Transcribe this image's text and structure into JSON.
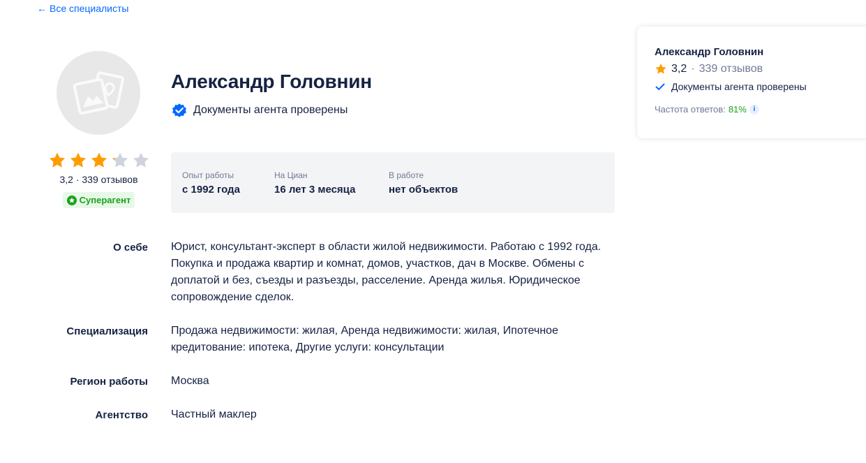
{
  "nav": {
    "back_arrow": "←",
    "back_label": "Все специалисты"
  },
  "profile": {
    "name": "Александр Головнин",
    "verified_text": "Документы агента проверены",
    "rating_text": "3,2 · 339 отзывов",
    "rating_value": 3.2,
    "rating_max": 5,
    "badge": "Суперагент"
  },
  "stats": [
    {
      "label": "Опыт работы",
      "value": "с 1992 года"
    },
    {
      "label": "На Циан",
      "value": "16 лет 3 месяца"
    },
    {
      "label": "В работе",
      "value": "нет объектов"
    }
  ],
  "info": [
    {
      "label": "О себе",
      "value": "Юрист, консультант-эксперт в области жилой недвижимости. Работаю с 1992 года. Покупка и продажа квартир и комнат, домов, участков, дач в Москве. Обмены с доплатой и без, съезды и разъезды, расселение. Аренда жилья. Юридическое сопровождение сделок."
    },
    {
      "label": "Специализация",
      "value": "Продажа недвижимости: жилая, Аренда недвижимости: жилая, Ипотечное кредитование: ипотека, Другие услуги: консультации"
    },
    {
      "label": "Регион работы",
      "value": "Москва"
    },
    {
      "label": "Агентство",
      "value": "Частный маклер"
    }
  ],
  "side_card": {
    "name": "Александр Головнин",
    "rating": "3,2",
    "separator": "·",
    "reviews": "339 отзывов",
    "verified_text": "Документы агента проверены",
    "freq_label": "Частота ответов:",
    "freq_value": "81%",
    "info_glyph": "i"
  },
  "colors": {
    "accent": "#0468ff",
    "star": "#ff9d00",
    "star_empty": "#cfd3dc",
    "success": "#19a319",
    "text": "#152242",
    "muted": "#707a95"
  }
}
